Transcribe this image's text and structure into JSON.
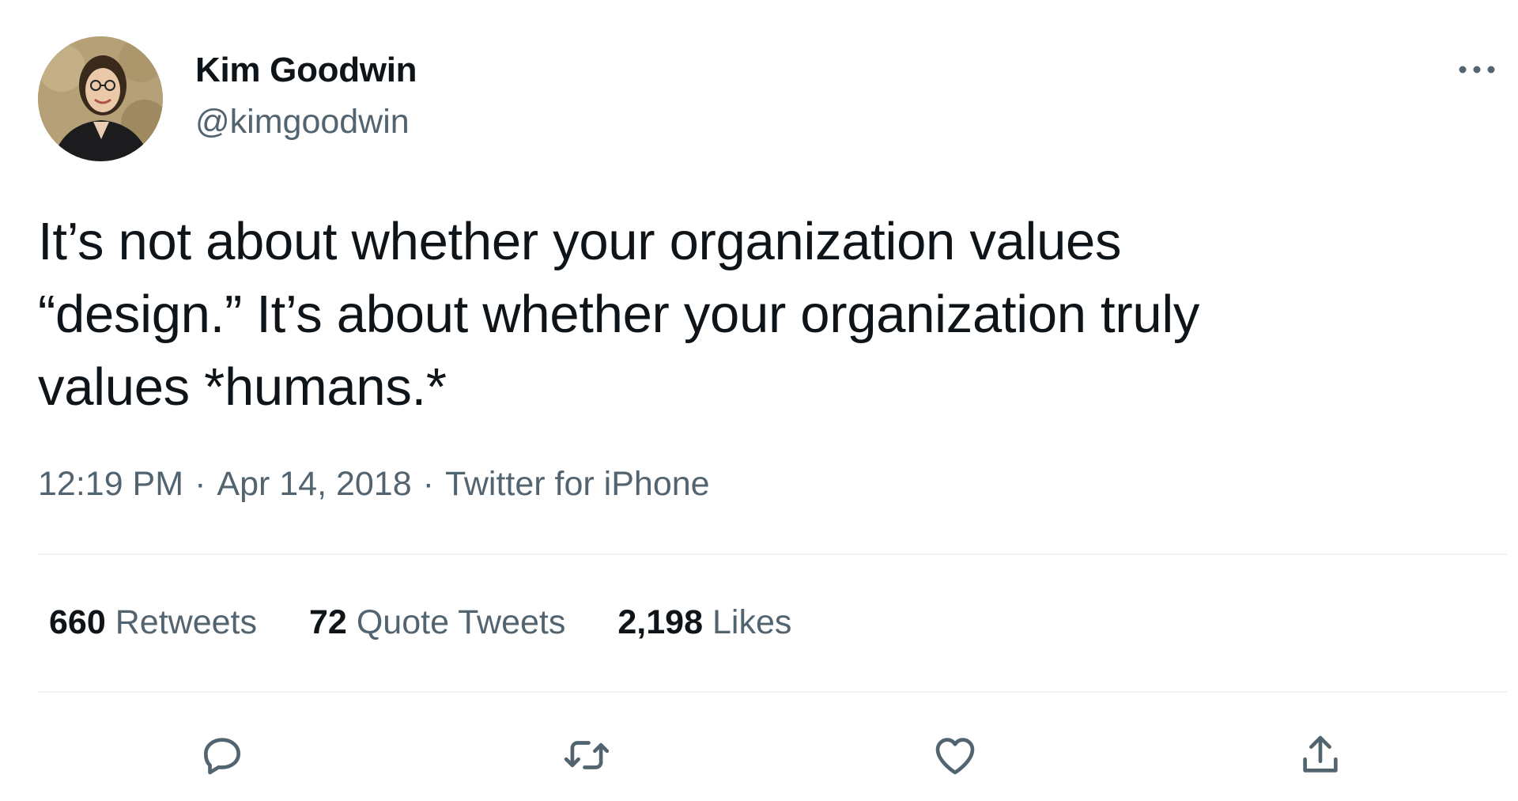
{
  "author": {
    "display_name": "Kim Goodwin",
    "handle": "@kimgoodwin"
  },
  "tweet": {
    "text": "It’s not about whether your organization values\n“design.” It’s about whether your organization truly\nvalues *humans.*",
    "time": "12:19 PM",
    "date": "Apr 14, 2018",
    "source": "Twitter for iPhone",
    "separator": "·"
  },
  "stats": {
    "retweets": {
      "count": "660",
      "label": "Retweets"
    },
    "quote_tweets": {
      "count": "72",
      "label": "Quote Tweets"
    },
    "likes": {
      "count": "2,198",
      "label": "Likes"
    }
  },
  "icons": {
    "more": "more-horizontal-icon",
    "reply": "reply-icon",
    "retweet": "retweet-icon",
    "like": "heart-icon",
    "share": "share-icon"
  },
  "colors": {
    "text": "#0f1419",
    "secondary": "#536471",
    "divider": "#eff3f4"
  }
}
